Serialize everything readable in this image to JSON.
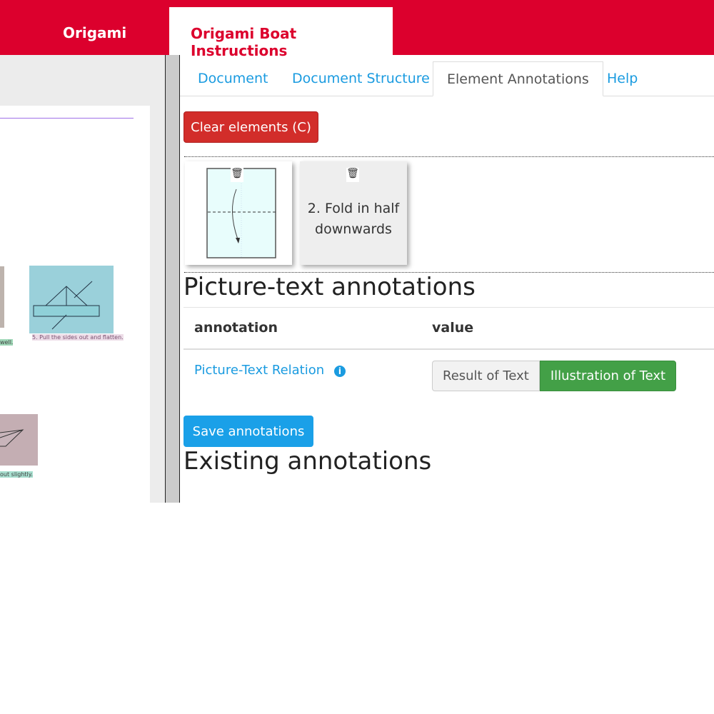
{
  "header": {
    "brand": "Origami",
    "document_tab": "Origami Boat Instructions"
  },
  "document_preview": {
    "captions": [
      "5. Pull the sides out and flatten.",
      "well.",
      "out slightly."
    ]
  },
  "tabs": [
    {
      "label": "Document"
    },
    {
      "label": "Document Structure"
    },
    {
      "label": "Element Annotations",
      "active": true
    },
    {
      "label": "Help"
    }
  ],
  "clear_button": "Clear elements (C)",
  "elements": [
    {
      "type": "image",
      "icon": "trash-icon"
    },
    {
      "type": "text",
      "text": "2. Fold in half downwards",
      "icon": "trash-icon"
    }
  ],
  "picture_text": {
    "title": "Picture-text annotations",
    "col_annotation": "annotation",
    "col_value": "value",
    "row": {
      "label": "Picture-Text Relation",
      "info_icon": "info-icon",
      "options": [
        "Result of Text",
        "Illustration of Text"
      ],
      "selected": "Illustration of Text"
    }
  },
  "save_button": "Save annotations",
  "existing_title": "Existing annotations",
  "colors": {
    "brand": "#dc002d",
    "link": "#1a9be0",
    "danger": "#d22d2a",
    "success": "#43a047",
    "primary": "#1aa0e8"
  }
}
